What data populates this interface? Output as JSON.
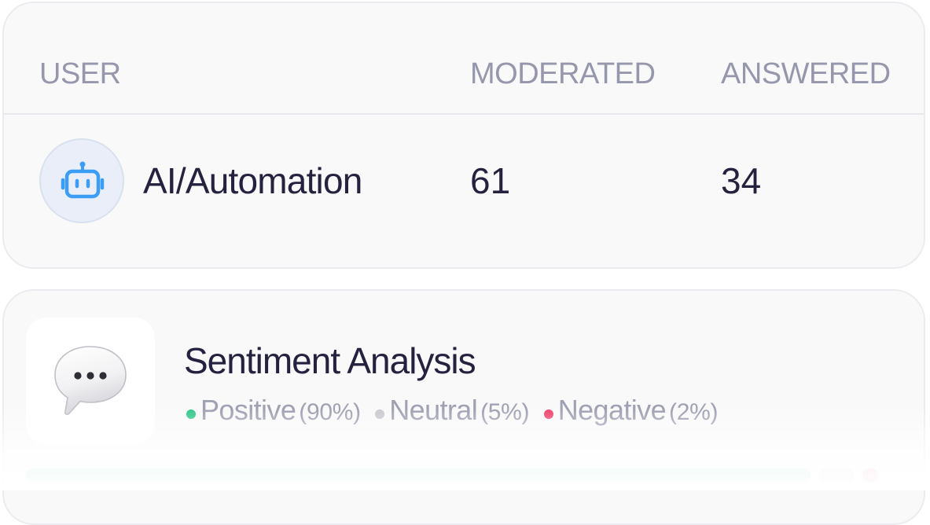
{
  "table": {
    "headers": {
      "user": "USER",
      "moderated": "MODERATED",
      "answered": "ANSWERED"
    },
    "rows": [
      {
        "icon": "robot-icon",
        "user": "AI/Automation",
        "moderated": "61",
        "answered": "34"
      }
    ]
  },
  "sentiment": {
    "icon": "speech-bubble-icon",
    "title": "Sentiment Analysis",
    "items": [
      {
        "label": "Positive",
        "percent": "(90%)",
        "value": 90,
        "color": "#34c98a"
      },
      {
        "label": "Neutral",
        "percent": "(5%)",
        "value": 5,
        "color": "#c9c9cf"
      },
      {
        "label": "Negative",
        "percent": "(2%)",
        "value": 2,
        "color": "#f0476f"
      }
    ]
  },
  "colors": {
    "accent_blue": "#3b9df6",
    "text_dark": "#24223e",
    "text_muted": "#9697ac"
  }
}
